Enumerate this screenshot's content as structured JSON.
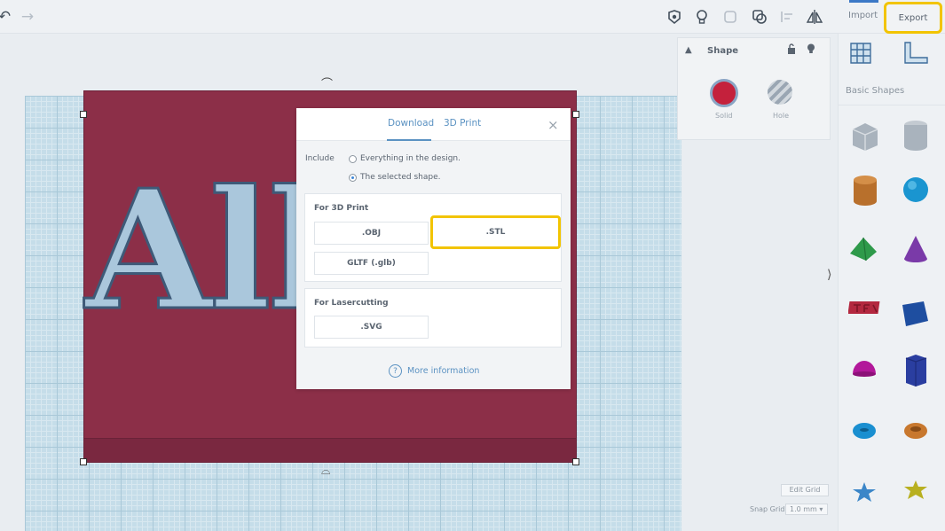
{
  "toolbar": {
    "import_label": "Import",
    "export_label": "Export",
    "icons": [
      "undo-icon",
      "redo-icon",
      "notes-icon",
      "bulb-icon",
      "group-icon",
      "ungroup-icon",
      "align-icon",
      "mirror-icon"
    ]
  },
  "shape_panel": {
    "title": "Shape",
    "solid_label": "Solid",
    "hole_label": "Hole",
    "solid_color": "#c4213c"
  },
  "sidebar": {
    "category_label": "Basic Shapes"
  },
  "canvas": {
    "shape_text": "All"
  },
  "dialog": {
    "tabs": [
      {
        "label": "Download",
        "active": true
      },
      {
        "label": "3D Print",
        "active": false
      }
    ],
    "include_label": "Include",
    "options": [
      {
        "label": "Everything in the design.",
        "selected": false
      },
      {
        "label": "The selected shape.",
        "selected": true
      }
    ],
    "section_3d_title": "For 3D Print",
    "formats_3d": [
      ".OBJ",
      ".STL",
      "GLTF (.glb)"
    ],
    "section_laser_title": "For Lasercutting",
    "formats_laser": [
      ".SVG"
    ],
    "more_info_label": "More information"
  },
  "grid": {
    "edit_grid_label": "Edit Grid",
    "snap_grid_label": "Snap Grid",
    "snap_value": "1.0 mm"
  },
  "colors": {
    "accent": "#5b92c2",
    "highlight": "#f2c400",
    "shape_red": "#8c2f48"
  }
}
